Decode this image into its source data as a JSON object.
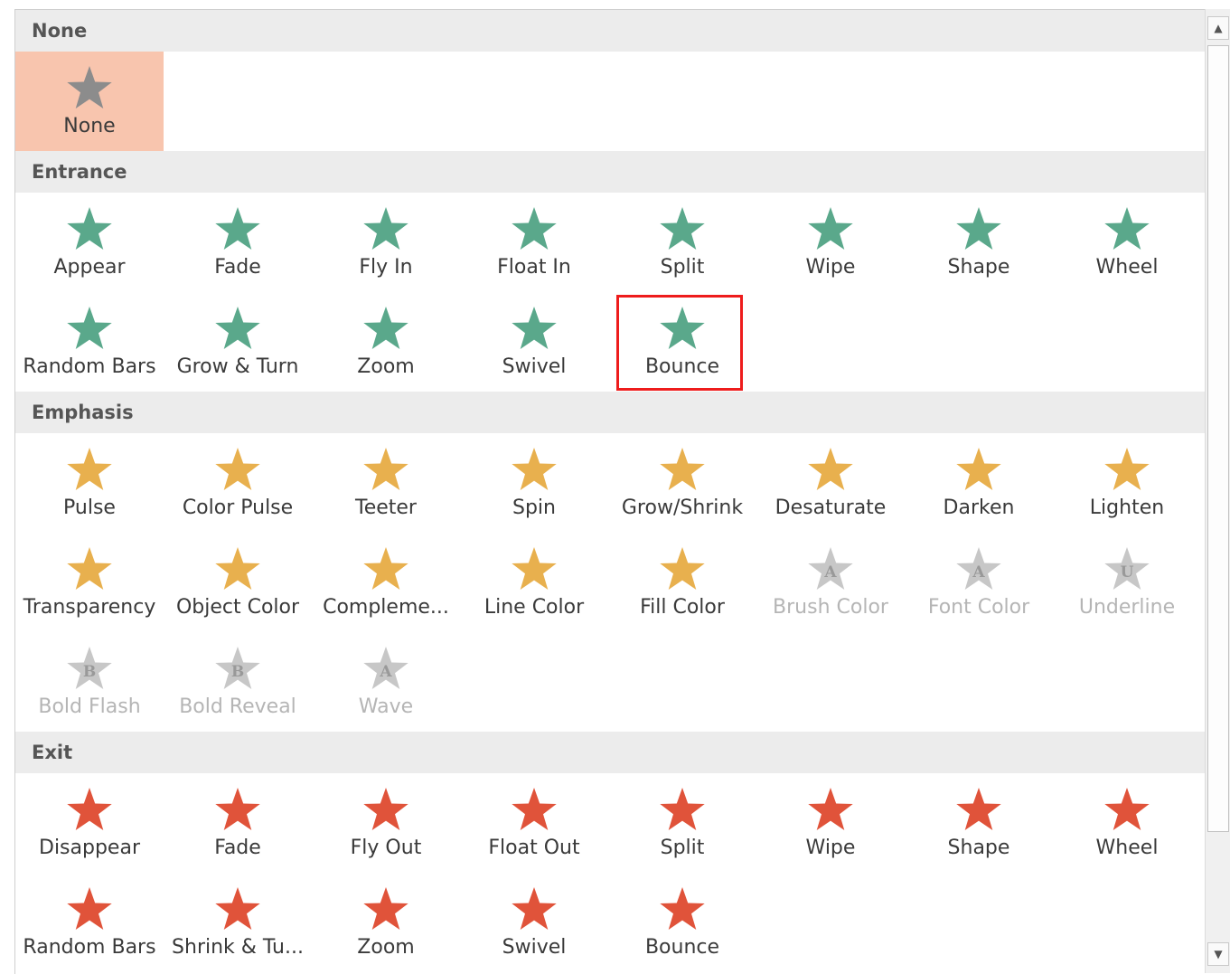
{
  "colors": {
    "none": "#8c8c8c",
    "entrance": "#5aa88b",
    "emphasis": "#e8b04e",
    "exit": "#e0533a",
    "disabled": "#c7c7c7",
    "selected_bg": "#f8c5ae",
    "highlight": "#ee1c1c"
  },
  "sections": [
    {
      "title": "None",
      "rows": [
        [
          {
            "label": "None",
            "icon": "star-none-icon",
            "style": "none",
            "selected": true
          }
        ]
      ]
    },
    {
      "title": "Entrance",
      "rows": [
        [
          {
            "label": "Appear",
            "icon": "appear-icon",
            "style": "entrance"
          },
          {
            "label": "Fade",
            "icon": "fade-icon",
            "style": "entrance"
          },
          {
            "label": "Fly In",
            "icon": "fly-in-icon",
            "style": "entrance"
          },
          {
            "label": "Float In",
            "icon": "float-in-icon",
            "style": "entrance"
          },
          {
            "label": "Split",
            "icon": "split-icon",
            "style": "entrance"
          },
          {
            "label": "Wipe",
            "icon": "wipe-icon",
            "style": "entrance"
          },
          {
            "label": "Shape",
            "icon": "shape-icon",
            "style": "entrance"
          },
          {
            "label": "Wheel",
            "icon": "wheel-icon",
            "style": "entrance"
          }
        ],
        [
          {
            "label": "Random Bars",
            "icon": "random-bars-icon",
            "style": "entrance"
          },
          {
            "label": "Grow & Turn",
            "icon": "grow-turn-icon",
            "style": "entrance"
          },
          {
            "label": "Zoom",
            "icon": "zoom-icon",
            "style": "entrance"
          },
          {
            "label": "Swivel",
            "icon": "swivel-icon",
            "style": "entrance"
          },
          {
            "label": "Bounce",
            "icon": "bounce-icon",
            "style": "entrance",
            "highlighted": true
          }
        ]
      ]
    },
    {
      "title": "Emphasis",
      "rows": [
        [
          {
            "label": "Pulse",
            "icon": "pulse-icon",
            "style": "emphasis"
          },
          {
            "label": "Color Pulse",
            "icon": "color-pulse-icon",
            "style": "emphasis"
          },
          {
            "label": "Teeter",
            "icon": "teeter-icon",
            "style": "emphasis"
          },
          {
            "label": "Spin",
            "icon": "spin-icon",
            "style": "emphasis"
          },
          {
            "label": "Grow/Shrink",
            "icon": "grow-shrink-icon",
            "style": "emphasis"
          },
          {
            "label": "Desaturate",
            "icon": "desaturate-icon",
            "style": "emphasis"
          },
          {
            "label": "Darken",
            "icon": "darken-icon",
            "style": "emphasis"
          },
          {
            "label": "Lighten",
            "icon": "lighten-icon",
            "style": "emphasis"
          }
        ],
        [
          {
            "label": "Transparency",
            "icon": "transparency-icon",
            "style": "emphasis"
          },
          {
            "label": "Object Color",
            "icon": "object-color-icon",
            "style": "emphasis"
          },
          {
            "label": "Compleme...",
            "icon": "complementary-color-icon",
            "style": "emphasis"
          },
          {
            "label": "Line Color",
            "icon": "line-color-icon",
            "style": "emphasis"
          },
          {
            "label": "Fill Color",
            "icon": "fill-color-icon",
            "style": "emphasis"
          },
          {
            "label": "Brush Color",
            "icon": "brush-color-icon",
            "style": "disabled",
            "letter": "A"
          },
          {
            "label": "Font Color",
            "icon": "font-color-icon",
            "style": "disabled",
            "letter": "A"
          },
          {
            "label": "Underline",
            "icon": "underline-icon",
            "style": "disabled",
            "letter": "U"
          }
        ],
        [
          {
            "label": "Bold Flash",
            "icon": "bold-flash-icon",
            "style": "disabled",
            "letter": "B"
          },
          {
            "label": "Bold Reveal",
            "icon": "bold-reveal-icon",
            "style": "disabled",
            "letter": "B"
          },
          {
            "label": "Wave",
            "icon": "wave-icon",
            "style": "disabled",
            "letter": "A"
          }
        ]
      ]
    },
    {
      "title": "Exit",
      "rows": [
        [
          {
            "label": "Disappear",
            "icon": "disappear-icon",
            "style": "exit"
          },
          {
            "label": "Fade",
            "icon": "fade-icon",
            "style": "exit"
          },
          {
            "label": "Fly Out",
            "icon": "fly-out-icon",
            "style": "exit"
          },
          {
            "label": "Float Out",
            "icon": "float-out-icon",
            "style": "exit"
          },
          {
            "label": "Split",
            "icon": "split-icon",
            "style": "exit"
          },
          {
            "label": "Wipe",
            "icon": "wipe-icon",
            "style": "exit"
          },
          {
            "label": "Shape",
            "icon": "shape-icon",
            "style": "exit"
          },
          {
            "label": "Wheel",
            "icon": "wheel-icon",
            "style": "exit"
          }
        ],
        [
          {
            "label": "Random Bars",
            "icon": "random-bars-icon",
            "style": "exit"
          },
          {
            "label": "Shrink & Tu...",
            "icon": "shrink-turn-icon",
            "style": "exit"
          },
          {
            "label": "Zoom",
            "icon": "zoom-icon",
            "style": "exit"
          },
          {
            "label": "Swivel",
            "icon": "swivel-icon",
            "style": "exit"
          },
          {
            "label": "Bounce",
            "icon": "bounce-icon",
            "style": "exit"
          }
        ]
      ]
    }
  ],
  "scrollbar": {
    "up_icon": "scroll-up-arrow-icon",
    "down_icon": "scroll-down-arrow-icon"
  }
}
